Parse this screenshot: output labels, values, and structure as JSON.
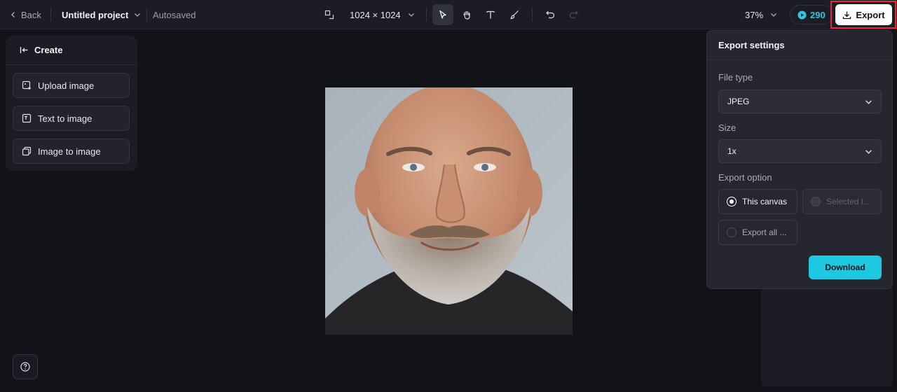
{
  "topbar": {
    "back_label": "Back",
    "project_title": "Untitled project",
    "autosaved": "Autosaved",
    "canvas_size": "1024 × 1024",
    "zoom": "37%",
    "credits": "290",
    "export_label": "Export"
  },
  "create_panel": {
    "title": "Create",
    "items": [
      {
        "label": "Upload image",
        "icon": "upload-image-icon"
      },
      {
        "label": "Text to image",
        "icon": "text-to-image-icon"
      },
      {
        "label": "Image to image",
        "icon": "image-to-image-icon"
      }
    ]
  },
  "export_settings": {
    "title": "Export settings",
    "file_type_label": "File type",
    "file_type_value": "JPEG",
    "size_label": "Size",
    "size_value": "1x",
    "export_option_label": "Export option",
    "options": [
      {
        "label": "This canvas",
        "selected": true,
        "enabled": true
      },
      {
        "label": "Selected l...",
        "selected": false,
        "enabled": false
      },
      {
        "label": "Export all ...",
        "selected": false,
        "enabled": true
      }
    ],
    "download_label": "Download"
  },
  "colors": {
    "accent": "#1ec8e1",
    "highlight": "#e8283a",
    "background": "#121318"
  }
}
